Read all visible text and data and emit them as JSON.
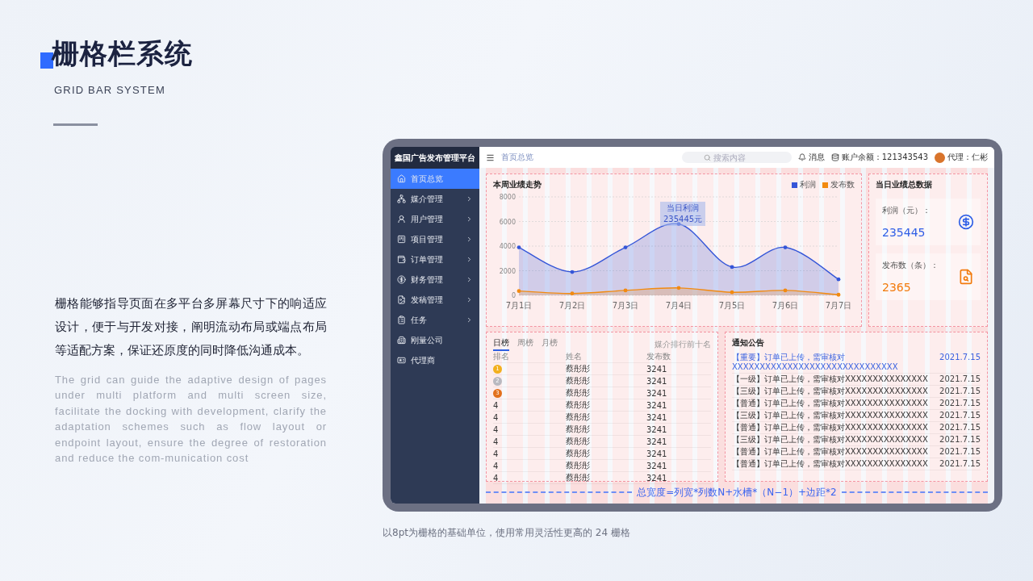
{
  "intro": {
    "title": "栅格栏系统",
    "subtitle": "GRID BAR SYSTEM",
    "text_cn": "栅格能够指导页面在多平台多屏幕尺寸下的响适应设计，便于与开发对接，阐明流动布局或端点布局等适配方案，保证还原度的同时降低沟通成本。",
    "text_en": "The grid can guide the adaptive design of pages under multi platform and multi screen size, facilitate the docking with development, clarify the adaptation schemes such as flow layout or endpoint layout, ensure the degree of restoration and reduce the com-munication cost"
  },
  "dashboard": {
    "app_title": "鑫国广告发布管理平台",
    "menu": [
      {
        "label": "首页总览",
        "selected": true,
        "has_submenu": false
      },
      {
        "label": "媒介管理",
        "selected": false,
        "has_submenu": true
      },
      {
        "label": "用户管理",
        "selected": false,
        "has_submenu": true
      },
      {
        "label": "项目管理",
        "selected": false,
        "has_submenu": true
      },
      {
        "label": "订单管理",
        "selected": false,
        "has_submenu": true
      },
      {
        "label": "财务管理",
        "selected": false,
        "has_submenu": true
      },
      {
        "label": "发稿管理",
        "selected": false,
        "has_submenu": true
      },
      {
        "label": "任务",
        "selected": false,
        "has_submenu": true
      },
      {
        "label": "刚量公司",
        "selected": false,
        "has_submenu": false
      },
      {
        "label": "代理商",
        "selected": false,
        "has_submenu": false
      }
    ],
    "topbar": {
      "breadcrumb": "首页总览",
      "search_placeholder": "搜索内容",
      "messages": "消息",
      "balance": "账户余额：121343543",
      "user": "代理：仁彬"
    },
    "trend": {
      "tooltip_label": "当日利润",
      "tooltip_value": "235445元",
      "chart_data": {
        "type": "area",
        "title": "本周业绩走势",
        "categories": [
          "7月1日",
          "7月2日",
          "7月3日",
          "7月4日",
          "7月5日",
          "7月6日",
          "7月7日"
        ],
        "series": [
          {
            "name": "利润",
            "color": "#3556d8",
            "values": [
              3900,
              1900,
              3900,
              5800,
              2300,
              3900,
              1300
            ]
          },
          {
            "name": "发布数",
            "color": "#f28a10",
            "values": [
              350,
              150,
              400,
              600,
              250,
              400,
              50
            ]
          }
        ],
        "ylim": [
          0,
          8000
        ],
        "grid": true,
        "yticks": [
          0,
          2000,
          4000,
          6000,
          8000
        ]
      }
    },
    "summary": {
      "title": "当日业绩总数据",
      "stats": [
        {
          "label": "利润（元）：",
          "value": "235445",
          "color": "#2e5ee6"
        },
        {
          "label": "发布数（条）：",
          "value": "2365",
          "color": "#f27a0c"
        }
      ]
    },
    "ranking": {
      "tabs": [
        {
          "label": "日榜",
          "selected": true
        },
        {
          "label": "周榜",
          "selected": false
        },
        {
          "label": "月榜",
          "selected": false
        }
      ],
      "note": "媒介排行前十名",
      "columns": [
        "排名",
        "姓名",
        "发布数"
      ],
      "rows": [
        {
          "rank": "1",
          "color": "#f2b01e",
          "name": "蔡彤彤",
          "count": "3241"
        },
        {
          "rank": "2",
          "color": "#b9b9c0",
          "name": "蔡彤彤",
          "count": "3241"
        },
        {
          "rank": "3",
          "color": "#e2701c",
          "name": "蔡彤彤",
          "count": "3241"
        },
        {
          "rank": "4",
          "name": "蔡彤彤",
          "count": "3241"
        },
        {
          "rank": "4",
          "name": "蔡彤彤",
          "count": "3241"
        },
        {
          "rank": "4",
          "name": "蔡彤彤",
          "count": "3241"
        },
        {
          "rank": "4",
          "name": "蔡彤彤",
          "count": "3241"
        },
        {
          "rank": "4",
          "name": "蔡彤彤",
          "count": "3241"
        },
        {
          "rank": "4",
          "name": "蔡彤彤",
          "count": "3241"
        },
        {
          "rank": "4",
          "name": "蔡彤彤",
          "count": "3241"
        }
      ]
    },
    "notices": {
      "title": "通知公告",
      "items": [
        {
          "text": "【重要】订单已上传，需审核对XXXXXXXXXXXXXXXXXXXXXXXXXXXXXX",
          "date": "2021.7.15",
          "important": true
        },
        {
          "text": "【一级】订单已上传，需审核对XXXXXXXXXXXXXXX",
          "date": "2021.7.15",
          "important": false
        },
        {
          "text": "【三级】订单已上传，需审核对XXXXXXXXXXXXXXX",
          "date": "2021.7.15",
          "important": false
        },
        {
          "text": "【普通】订单已上传，需审核对XXXXXXXXXXXXXXX",
          "date": "2021.7.15",
          "important": false
        },
        {
          "text": "【三级】订单已上传，需审核对XXXXXXXXXXXXXXX",
          "date": "2021.7.15",
          "important": false
        },
        {
          "text": "【普通】订单已上传，需审核对XXXXXXXXXXXXXXX",
          "date": "2021.7.15",
          "important": false
        },
        {
          "text": "【三级】订单已上传，需审核对XXXXXXXXXXXXXXX",
          "date": "2021.7.15",
          "important": false
        },
        {
          "text": "【普通】订单已上传，需审核对XXXXXXXXXXXXXXX",
          "date": "2021.7.15",
          "important": false
        },
        {
          "text": "【普通】订单已上传，需审核对XXXXXXXXXXXXXXX",
          "date": "2021.7.15",
          "important": false
        }
      ]
    },
    "formula": "总宽度=列宽*列数N+水槽*（N−1）+边距*2"
  },
  "caption": "以8pt为栅格的基础单位，使用常用灵活性更高的 24 栅格"
}
